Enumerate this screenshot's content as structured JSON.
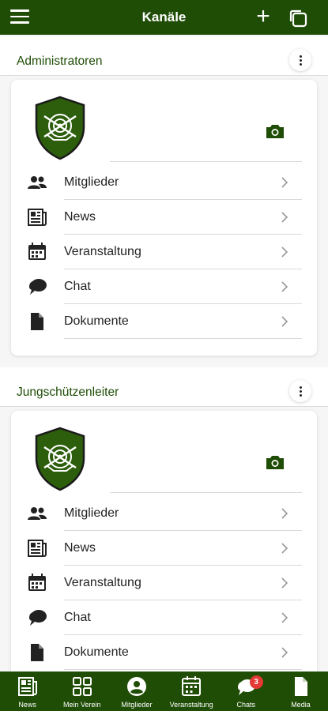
{
  "header": {
    "title": "Kanäle",
    "menu_icon": "hamburger-menu-icon",
    "add_icon": "plus-icon",
    "copy_icon": "copy-icon"
  },
  "colors": {
    "primary": "#1f4d06",
    "badge": "#e53935"
  },
  "channels": [
    {
      "name": "Administratoren",
      "items": [
        {
          "label": "Mitglieder",
          "icon": "members-icon"
        },
        {
          "label": "News",
          "icon": "news-icon"
        },
        {
          "label": "Veranstaltung",
          "icon": "calendar-icon"
        },
        {
          "label": "Chat",
          "icon": "chat-icon"
        },
        {
          "label": "Dokumente",
          "icon": "document-icon"
        }
      ]
    },
    {
      "name": "Jungschützenleiter",
      "items": [
        {
          "label": "Mitglieder",
          "icon": "members-icon"
        },
        {
          "label": "News",
          "icon": "news-icon"
        },
        {
          "label": "Veranstaltung",
          "icon": "calendar-icon"
        },
        {
          "label": "Chat",
          "icon": "chat-icon"
        },
        {
          "label": "Dokumente",
          "icon": "document-icon"
        }
      ]
    }
  ],
  "bottom_nav": [
    {
      "label": "News",
      "icon": "news-icon"
    },
    {
      "label": "Mein Verein",
      "icon": "grid-icon"
    },
    {
      "label": "Mitglieder",
      "icon": "user-circle-icon"
    },
    {
      "label": "Veranstaltung",
      "icon": "calendar-icon"
    },
    {
      "label": "Chats",
      "icon": "chat-icon",
      "badge": "3"
    },
    {
      "label": "Media",
      "icon": "document-icon"
    }
  ]
}
